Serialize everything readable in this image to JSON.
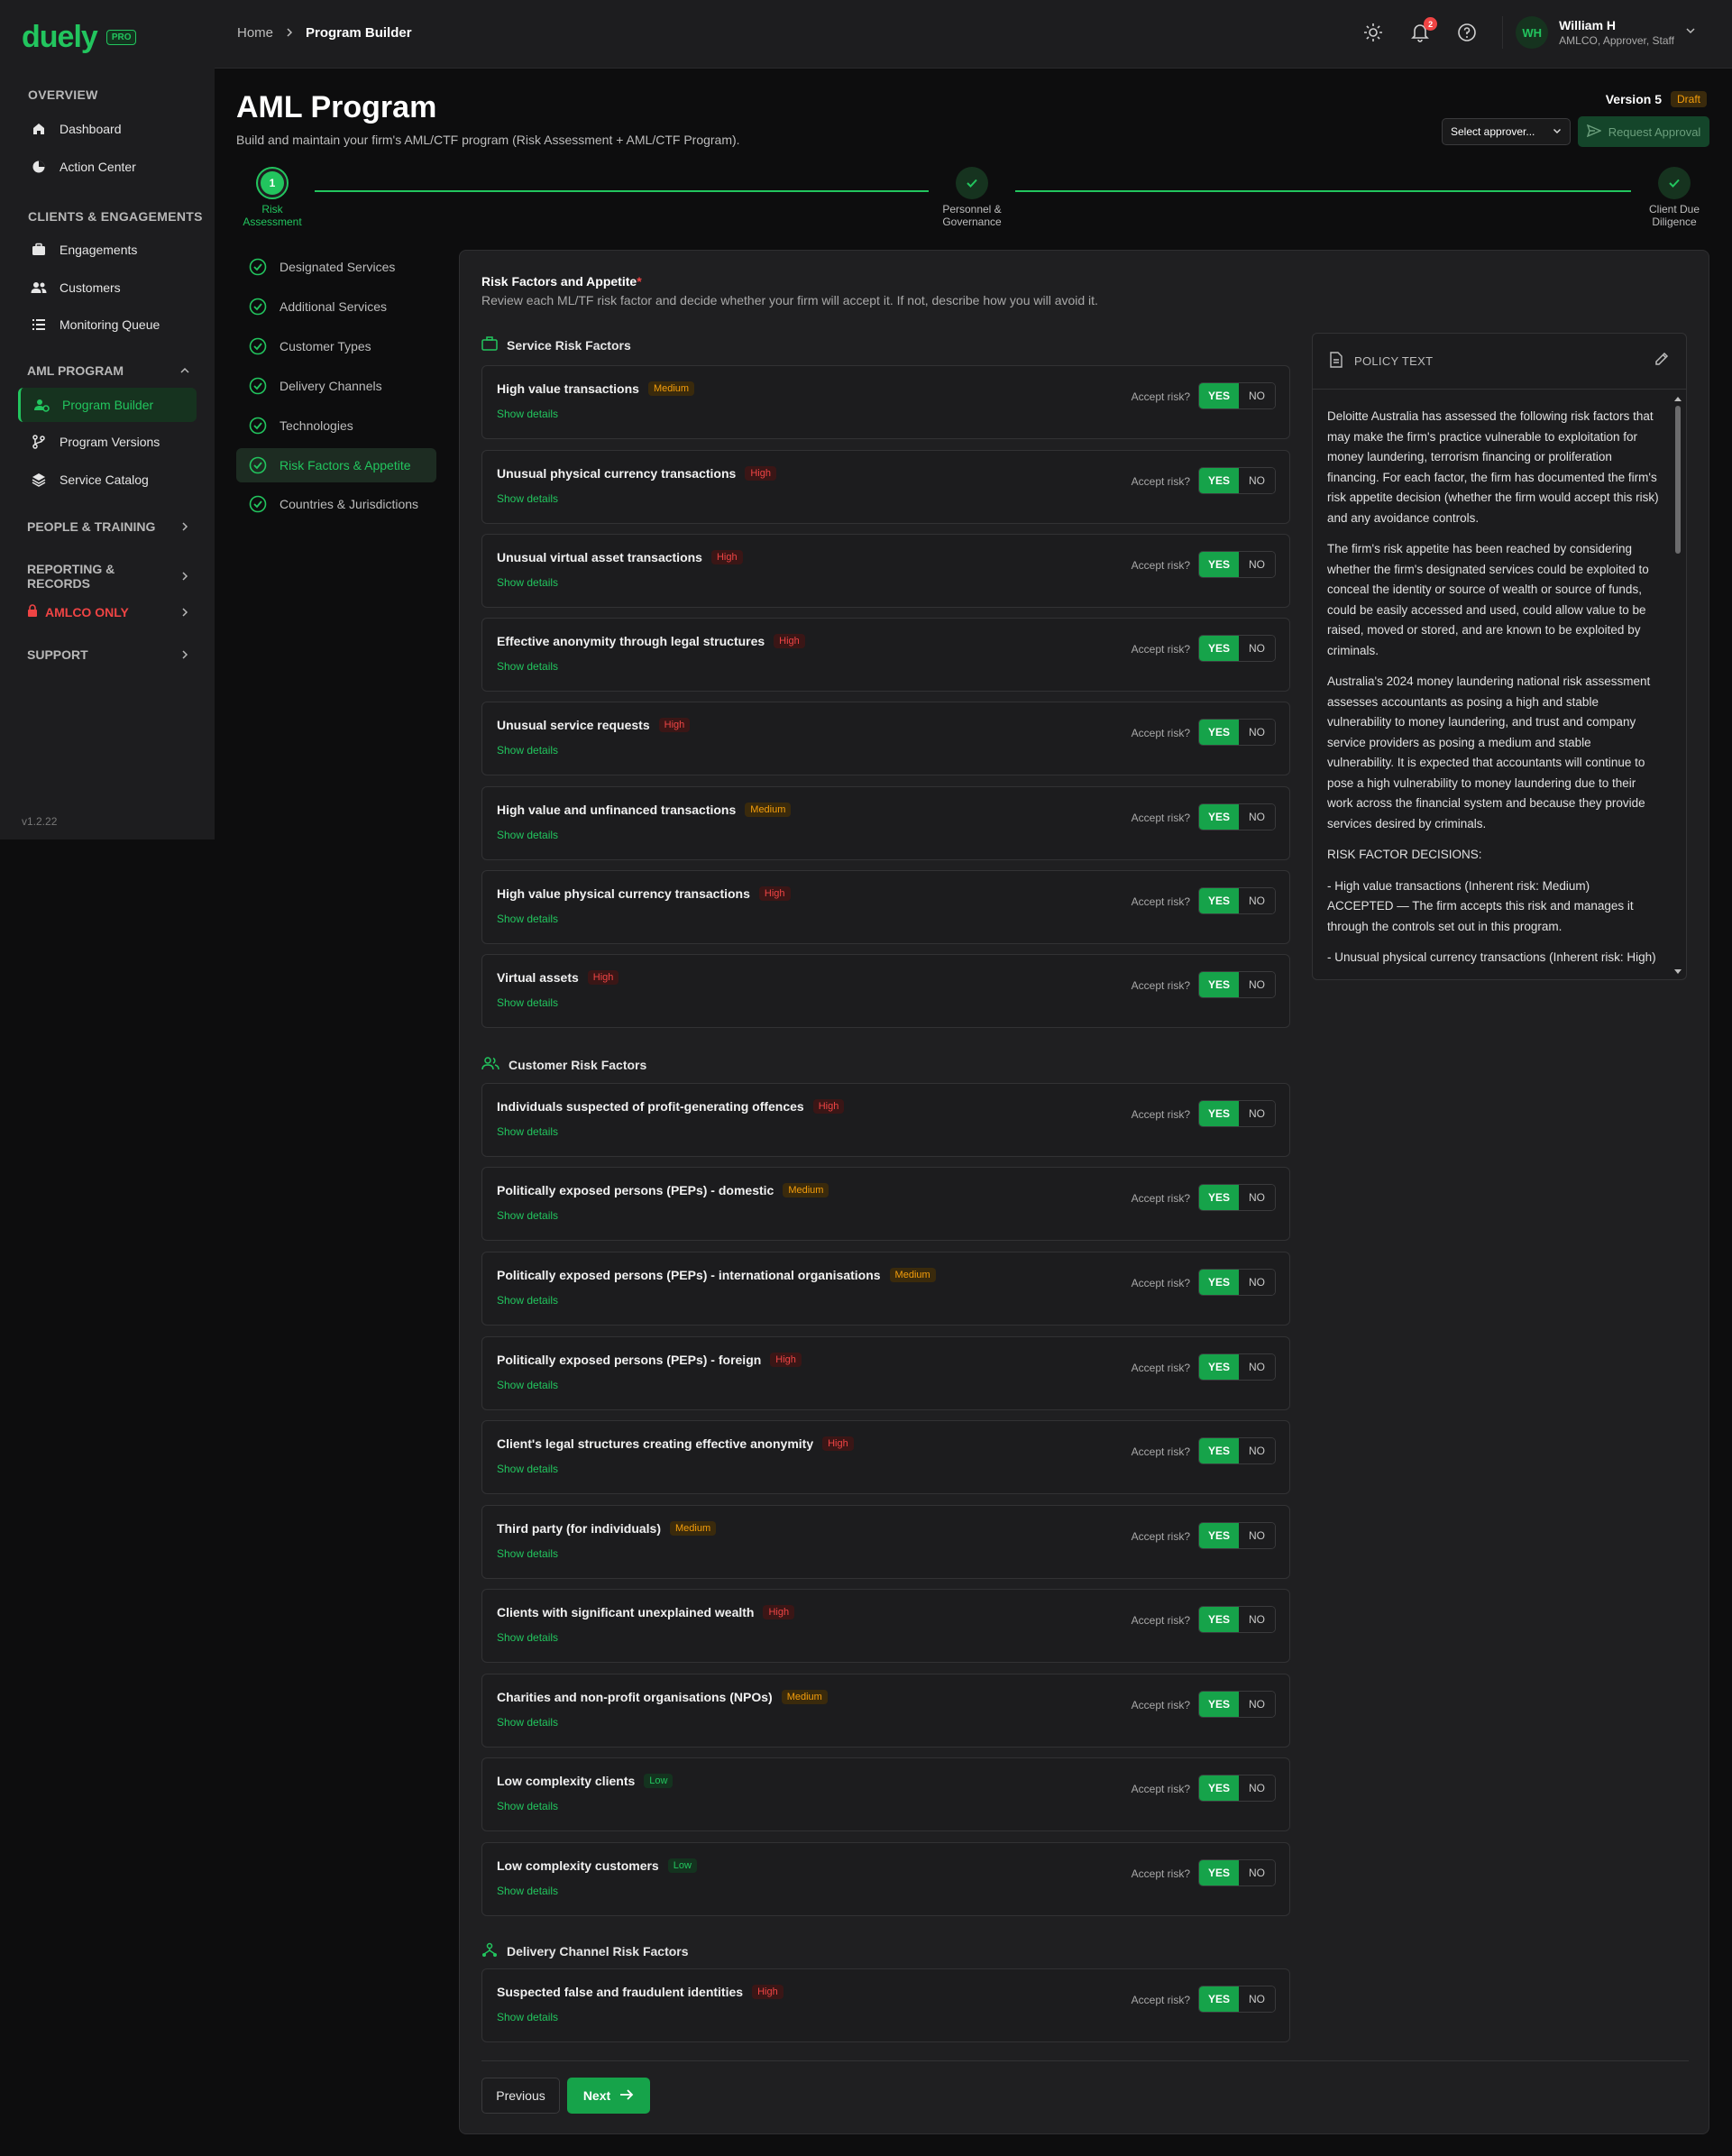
{
  "brand": {
    "logo": "duely",
    "badge": "PRO"
  },
  "sidebar": {
    "sections": [
      {
        "label": "OVERVIEW",
        "items": [
          {
            "label": "Dashboard",
            "icon": "home-icon"
          },
          {
            "label": "Action Center",
            "icon": "pie-chart-icon"
          }
        ]
      },
      {
        "label": "CLIENTS & ENGAGEMENTS",
        "items": [
          {
            "label": "Engagements",
            "icon": "briefcase-icon"
          },
          {
            "label": "Customers",
            "icon": "users-icon"
          },
          {
            "label": "Monitoring Queue",
            "icon": "list-icon"
          }
        ]
      },
      {
        "label": "AML PROGRAM",
        "items": [
          {
            "label": "Program Builder",
            "icon": "user-gear-icon"
          },
          {
            "label": "Program Versions",
            "icon": "branch-icon"
          },
          {
            "label": "Service Catalog",
            "icon": "layers-icon"
          }
        ]
      }
    ],
    "groups": [
      "PEOPLE & TRAINING",
      "REPORTING & RECORDS",
      "AMLCO ONLY",
      "SUPPORT"
    ],
    "version": "v1.2.22"
  },
  "topbar": {
    "breadcrumb": [
      "Home",
      "Program Builder"
    ],
    "notifications": "2",
    "user": {
      "initials": "WH",
      "name": "William H",
      "role": "AMLCO, Approver, Staff"
    }
  },
  "header": {
    "title": "AML Program",
    "subtitle": "Build and maintain your firm's AML/CTF program (Risk Assessment + AML/CTF Program).",
    "version": "Version 5",
    "status": "Draft",
    "approver_placeholder": "Select approver...",
    "request_label": "Request Approval"
  },
  "stepper": [
    {
      "number": "1",
      "label": "Risk\nAssessment"
    },
    {
      "label": "Personnel &\nGovernance"
    },
    {
      "label": "Client Due\nDiligence"
    }
  ],
  "substeps": [
    "Designated Services",
    "Additional Services",
    "Customer Types",
    "Delivery Channels",
    "Technologies",
    "Risk Factors & Appetite",
    "Countries & Jurisdictions"
  ],
  "panel": {
    "title": "Risk Factors and Appetite",
    "required_mark": "*",
    "subtitle": "Review each ML/TF risk factor and decide whether your firm will accept it. If not, describe how you will avoid it.",
    "accept_label": "Accept risk?",
    "details_label": "Show details",
    "yes_label": "YES",
    "no_label": "NO",
    "groups": [
      {
        "title": "Service Risk Factors",
        "icon": "briefcase-icon",
        "factors": [
          {
            "name": "High value transactions",
            "level": "Medium"
          },
          {
            "name": "Unusual physical currency transactions",
            "level": "High"
          },
          {
            "name": "Unusual virtual asset transactions",
            "level": "High"
          },
          {
            "name": "Effective anonymity through legal structures",
            "level": "High"
          },
          {
            "name": "Unusual service requests",
            "level": "High"
          },
          {
            "name": "High value and unfinanced transactions",
            "level": "Medium"
          },
          {
            "name": "High value physical currency transactions",
            "level": "High"
          },
          {
            "name": "Virtual assets",
            "level": "High"
          }
        ]
      },
      {
        "title": "Customer Risk Factors",
        "icon": "users-icon",
        "factors": [
          {
            "name": "Individuals suspected of profit-generating offences",
            "level": "High"
          },
          {
            "name": "Politically exposed persons (PEPs) - domestic",
            "level": "Medium"
          },
          {
            "name": "Politically exposed persons (PEPs) - international organisations",
            "level": "Medium"
          },
          {
            "name": "Politically exposed persons (PEPs) - foreign",
            "level": "High"
          },
          {
            "name": "Client's legal structures creating effective anonymity",
            "level": "High"
          },
          {
            "name": "Third party (for individuals)",
            "level": "Medium"
          },
          {
            "name": "Clients with significant unexplained wealth",
            "level": "High"
          },
          {
            "name": "Charities and non-profit organisations (NPOs)",
            "level": "Medium"
          },
          {
            "name": "Low complexity clients",
            "level": "Low"
          },
          {
            "name": "Low complexity customers",
            "level": "Low"
          }
        ]
      },
      {
        "title": "Delivery Channel Risk Factors",
        "icon": "network-icon",
        "factors": [
          {
            "name": "Suspected false and fraudulent identities",
            "level": "High"
          }
        ]
      }
    ],
    "policy": {
      "label": "POLICY TEXT",
      "paragraphs": [
        "Deloitte Australia has assessed the following risk factors that may make the firm's practice vulnerable to exploitation for money laundering, terrorism financing or proliferation financing. For each factor, the firm has documented the firm's risk appetite decision (whether the firm would accept this risk) and any avoidance controls.",
        "The firm's risk appetite has been reached by considering whether the firm's designated services could be exploited to conceal the identity or source of wealth or source of funds, could be easily accessed and used, could allow value to be raised, moved or stored, and are known to be exploited by criminals.",
        "Australia's 2024 money laundering national risk assessment assesses accountants as posing a high and stable vulnerability to money laundering, and trust and company service providers as posing a medium and stable vulnerability. It is expected that accountants will continue to pose a high vulnerability to money laundering due to their work across the financial system and because they provide services desired by criminals.",
        "RISK FACTOR DECISIONS:",
        "- High value transactions (Inherent risk: Medium)\n  ACCEPTED — The firm accepts this risk and manages it through the controls set out in this program.",
        "- Unusual physical currency transactions (Inherent risk: High)"
      ]
    },
    "prev_label": "Previous",
    "next_label": "Next"
  },
  "colors": {
    "accent": "#22c55e",
    "high": "#ef4444",
    "medium": "#f59e0b",
    "background": "#0d0d0e"
  }
}
